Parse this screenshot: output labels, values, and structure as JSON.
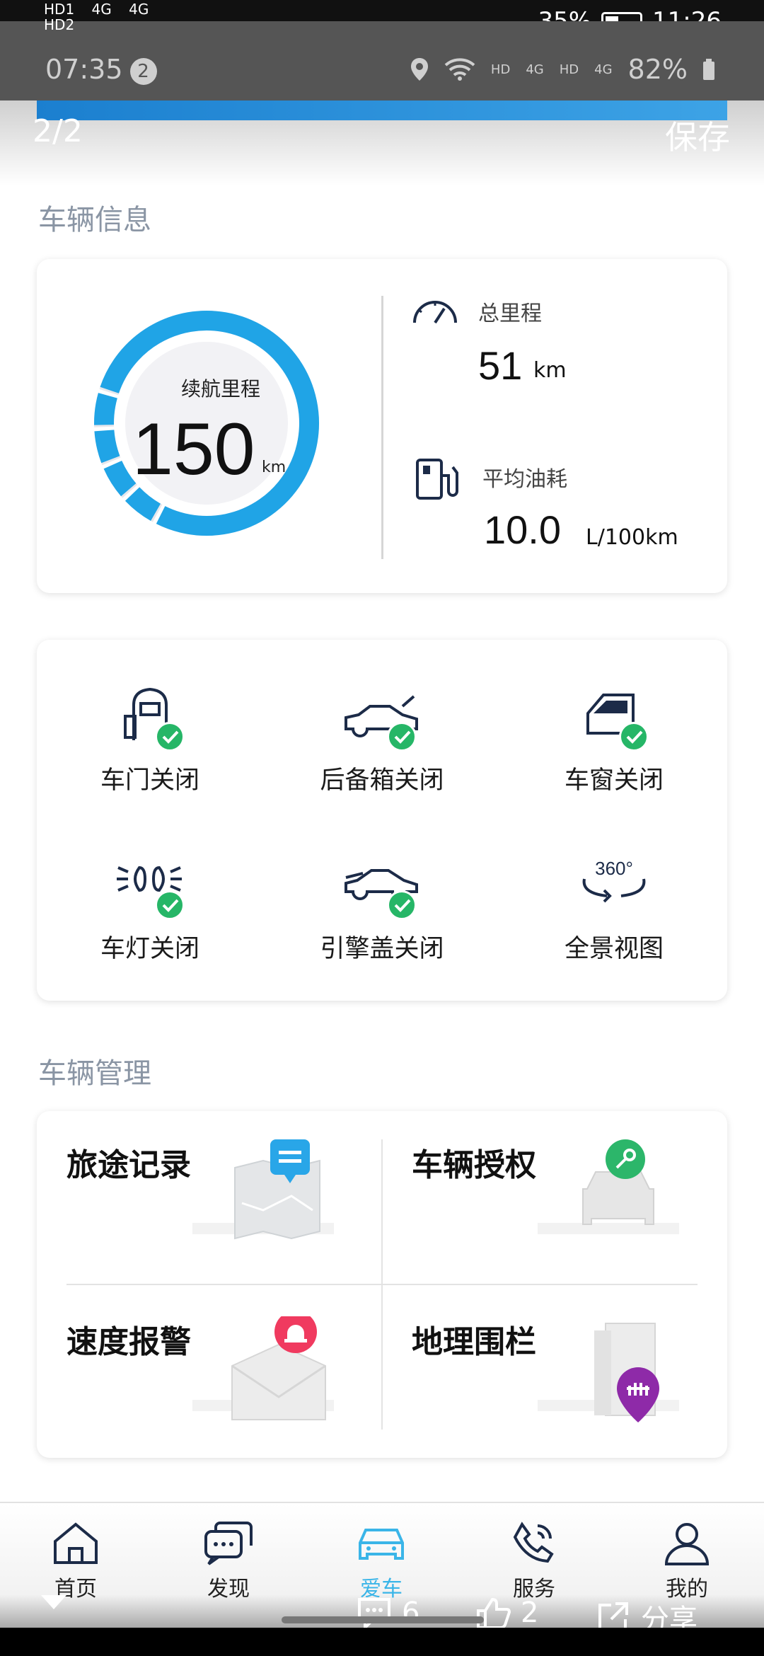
{
  "system": {
    "top_left_tags": [
      "HD1",
      "HD2",
      "4G",
      "4G"
    ],
    "battery_percent": "35%",
    "time": "11:26"
  },
  "statusbar": {
    "time": "07:35",
    "badge_count": "2",
    "hd_labels": [
      "HD",
      "4G",
      "HD",
      "4G"
    ],
    "battery": "82%"
  },
  "header": {
    "pager": "2/2",
    "save_label": "保存"
  },
  "vehicle_info": {
    "section_title": "车辆信息",
    "range_label": "续航里程",
    "range_value": "150",
    "range_unit": "km",
    "range_fraction": 0.27,
    "odometer_label": "总里程",
    "odometer_value": "51",
    "odometer_unit": "km",
    "fuel_label": "平均油耗",
    "fuel_value": "10.0",
    "fuel_unit": "L/100km",
    "accent_color": "#20a4e6"
  },
  "status": {
    "items": [
      {
        "label": "车门关闭",
        "icon": "car-door-icon",
        "checked": true
      },
      {
        "label": "后备箱关闭",
        "icon": "trunk-icon",
        "checked": true
      },
      {
        "label": "车窗关闭",
        "icon": "car-window-icon",
        "checked": true
      },
      {
        "label": "车灯关闭",
        "icon": "headlight-icon",
        "checked": true
      },
      {
        "label": "引擎盖关闭",
        "icon": "hood-icon",
        "checked": true
      },
      {
        "label": "全景视图",
        "icon": "panorama-360-icon",
        "checked": false
      }
    ],
    "panorama_text": "360°",
    "check_color": "#26b667"
  },
  "management": {
    "section_title": "车辆管理",
    "items": [
      {
        "label": "旅途记录",
        "icon": "trip-map-icon"
      },
      {
        "label": "车辆授权",
        "icon": "car-key-auth-icon"
      },
      {
        "label": "速度报警",
        "icon": "speed-alarm-icon"
      },
      {
        "label": "地理围栏",
        "icon": "geofence-icon"
      }
    ]
  },
  "nav": {
    "items": [
      {
        "label": "首页",
        "icon": "home-icon"
      },
      {
        "label": "发现",
        "icon": "discover-chat-icon"
      },
      {
        "label": "爱车",
        "icon": "car-icon",
        "active": true
      },
      {
        "label": "服务",
        "icon": "service-phone-icon"
      },
      {
        "label": "我的",
        "icon": "profile-icon"
      }
    ],
    "active_color": "#3ab5e8"
  },
  "overlay": {
    "comments_count": "6",
    "likes_count": "2",
    "share_label": "分享"
  }
}
